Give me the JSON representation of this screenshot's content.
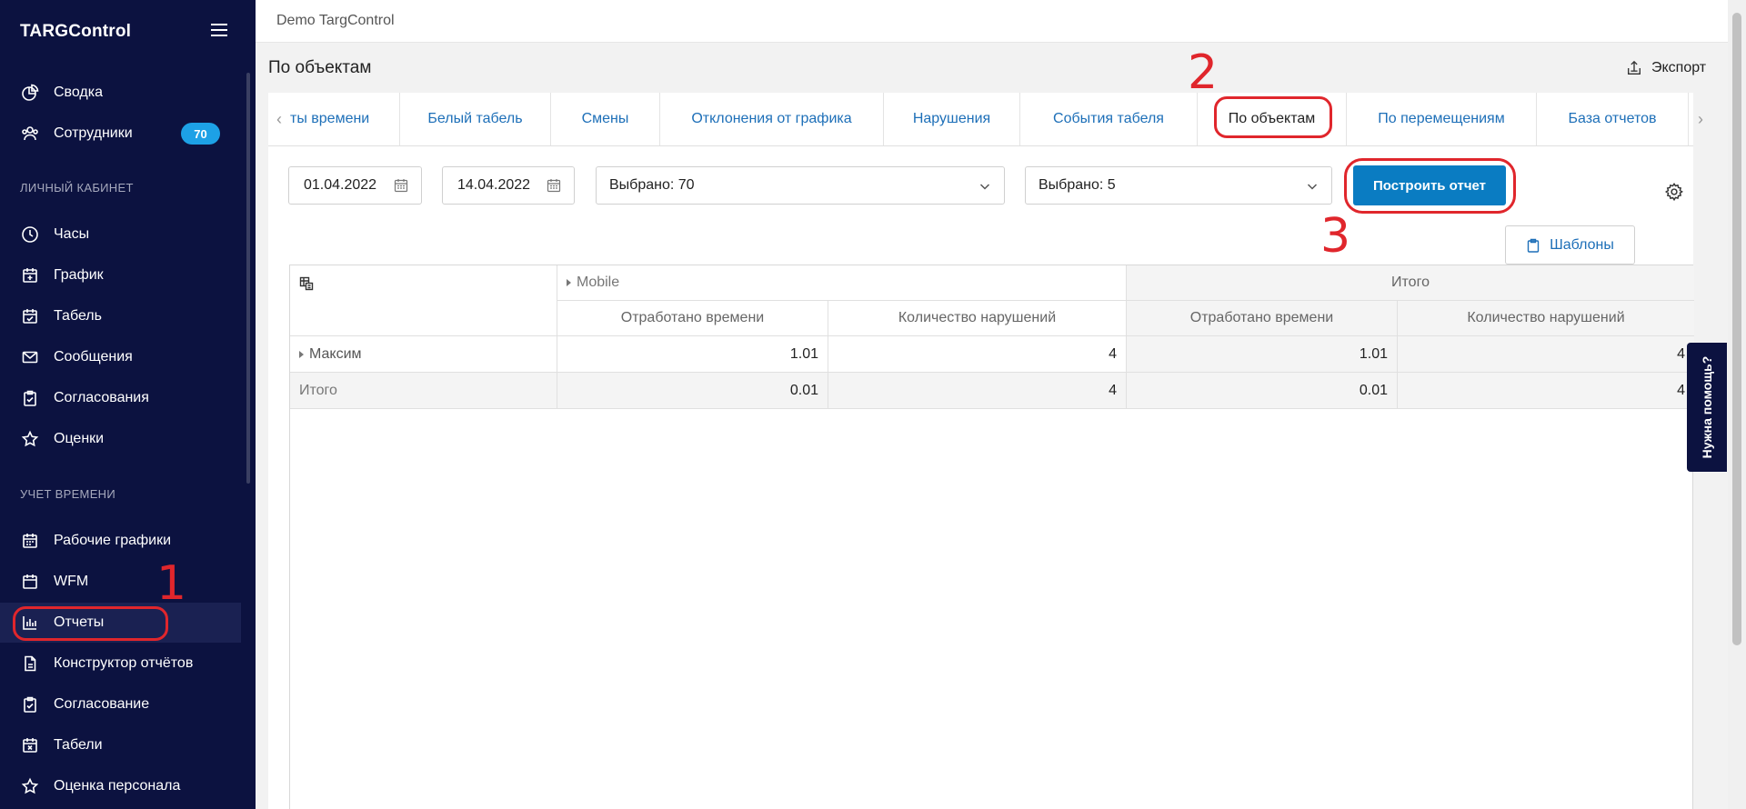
{
  "app": {
    "brand": "TARGControl",
    "window_title": "Demo TargControl"
  },
  "sidebar": {
    "items_top": [
      {
        "label": "Сводка",
        "icon": "chart-pie-icon"
      },
      {
        "label": "Сотрудники",
        "icon": "users-icon",
        "badge": "70"
      }
    ],
    "section_personal": "ЛИЧНЫЙ КАБИНЕТ",
    "items_personal": [
      {
        "label": "Часы",
        "icon": "clock-icon"
      },
      {
        "label": "График",
        "icon": "calendar-plus-icon"
      },
      {
        "label": "Табель",
        "icon": "calendar-check-icon"
      },
      {
        "label": "Сообщения",
        "icon": "envelope-icon"
      },
      {
        "label": "Согласования",
        "icon": "clipboard-check-icon"
      },
      {
        "label": "Оценки",
        "icon": "star-icon"
      }
    ],
    "section_time": "УЧЕТ ВРЕМЕНИ",
    "items_time": [
      {
        "label": "Рабочие графики",
        "icon": "calendar-grid-icon"
      },
      {
        "label": "WFM",
        "icon": "calendar-icon"
      },
      {
        "label": "Отчеты",
        "icon": "bar-chart-icon",
        "active": true
      },
      {
        "label": "Конструктор отчётов",
        "icon": "document-icon"
      },
      {
        "label": "Согласование",
        "icon": "clipboard-check-icon"
      },
      {
        "label": "Табели",
        "icon": "calendar-x-icon"
      },
      {
        "label": "Оценка персонала",
        "icon": "star-icon"
      }
    ]
  },
  "main": {
    "page_title": "По объектам",
    "export_label": "Экспорт",
    "tabs": [
      "ты времени",
      "Белый табель",
      "Смены",
      "Отклонения от графика",
      "Нарушения",
      "События табеля",
      "По объектам",
      "По перемещениям",
      "База отчетов"
    ],
    "active_tab": "По объектам",
    "filters": {
      "date_from": "01.04.2022",
      "date_to": "14.04.2022",
      "select_1": "Выбрано: 70",
      "select_2": "Выбрано: 5"
    },
    "build_button": "Построить отчет",
    "templates_button": "Шаблоны"
  },
  "pivot": {
    "group_mobile": "Mobile",
    "group_total": "Итого",
    "col_worked": "Отработано времени",
    "col_violations": "Количество нарушений",
    "rows": [
      {
        "label": "Максим",
        "worked": "1.01",
        "violations": "4",
        "total_worked": "1.01",
        "total_violations": "4"
      },
      {
        "label": "Итого",
        "worked": "0.01",
        "violations": "4",
        "total_worked": "0.01",
        "total_violations": "4"
      }
    ]
  },
  "help": {
    "label": "Нужна помощь?"
  },
  "annotations": {
    "one": "1",
    "two": "2",
    "three": "3"
  },
  "colors": {
    "sidebar_bg": "#0c1240",
    "accent": "#0a7cc2",
    "link": "#1d6fb8",
    "annotation": "#e0262c"
  }
}
